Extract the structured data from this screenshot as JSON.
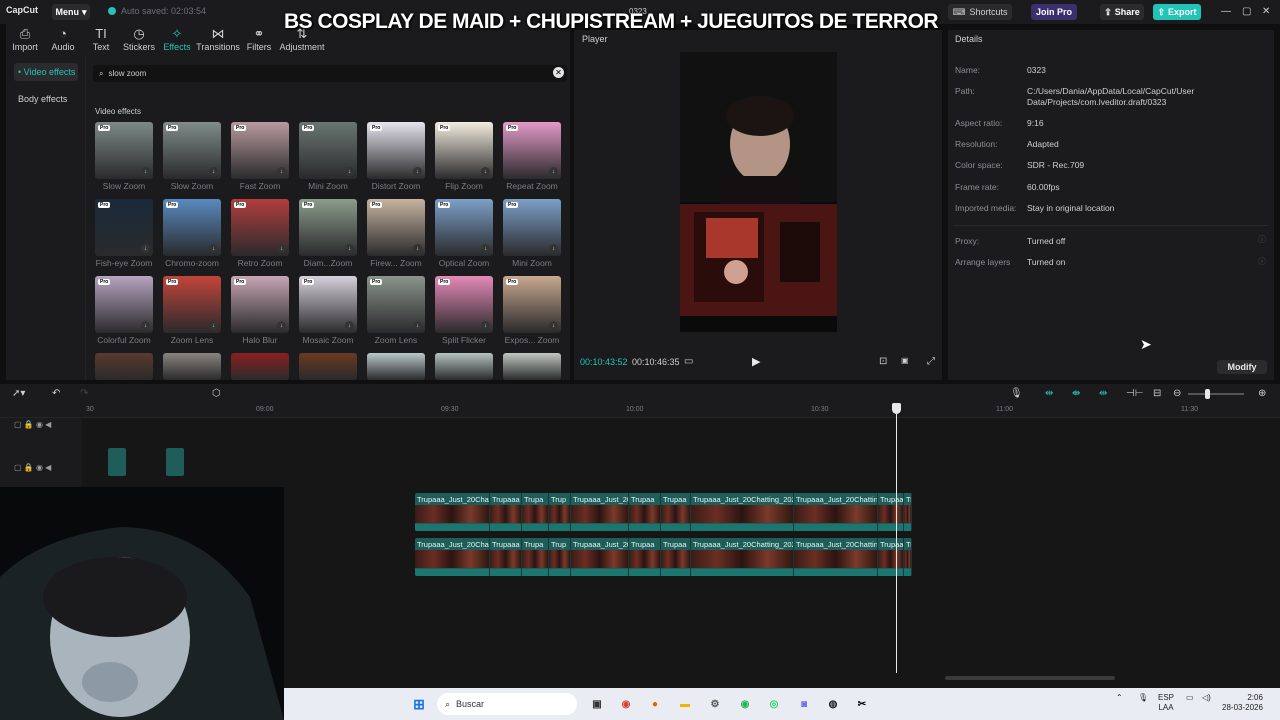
{
  "titlebar": {
    "app_name": "CapCut",
    "menu_label": "Menu",
    "autosave_text": "Auto saved: 02:03:54",
    "overlay_title": "BS COSPLAY DE MAID + CHUPISTREAM + JUEGUITOS DE TERROR",
    "project_name": "0323",
    "shortcuts_label": "Shortcuts",
    "joinpro_label": "Join Pro",
    "share_label": "Share",
    "export_label": "Export"
  },
  "toolbar": {
    "items": [
      {
        "label": "Import",
        "icon": "import-icon"
      },
      {
        "label": "Audio",
        "icon": "audio-icon"
      },
      {
        "label": "Text",
        "icon": "text-icon"
      },
      {
        "label": "Stickers",
        "icon": "stickers-icon"
      },
      {
        "label": "Effects",
        "icon": "effects-icon"
      },
      {
        "label": "Transitions",
        "icon": "transitions-icon"
      },
      {
        "label": "Filters",
        "icon": "filters-icon"
      },
      {
        "label": "Adjustment",
        "icon": "adjustment-icon"
      }
    ],
    "active": "Effects"
  },
  "categories": {
    "video_effects": "• Video effects",
    "body_effects": "Body effects"
  },
  "search": {
    "value": "slow zoom"
  },
  "effects": {
    "section_label": "Video effects",
    "items": [
      {
        "label": "Slow Zoom",
        "color": "#7d8a88"
      },
      {
        "label": "Slow Zoom",
        "color": "#808c8a"
      },
      {
        "label": "Fast Zoom",
        "color": "#b89a9e"
      },
      {
        "label": "Mini Zoom",
        "color": "#6a7672"
      },
      {
        "label": "Distort Zoom",
        "color": "#e6e4ee"
      },
      {
        "label": "Flip Zoom",
        "color": "#f3ecdf"
      },
      {
        "label": "Repeat Zoom",
        "color": "#e39ac7"
      },
      {
        "label": "Fish-eye Zoom",
        "color": "#1a2a3a"
      },
      {
        "label": "Chromo-zoom",
        "color": "#5a8ac0"
      },
      {
        "label": "Retro Zoom",
        "color": "#b13e3e"
      },
      {
        "label": "Diam...Zoom",
        "color": "#8c9c8c"
      },
      {
        "label": "Firew... Zoom",
        "color": "#c7b49f"
      },
      {
        "label": "Optical Zoom",
        "color": "#7ca0c8"
      },
      {
        "label": "Mini Zoom",
        "color": "#7ca0c8"
      },
      {
        "label": "Colorful Zoom",
        "color": "#b6a4c0"
      },
      {
        "label": "Zoom Lens",
        "color": "#c2453b"
      },
      {
        "label": "Halo Blur",
        "color": "#c7a6b4"
      },
      {
        "label": "Mosaic Zoom",
        "color": "#d6d0db"
      },
      {
        "label": "Zoom Lens",
        "color": "#8a948c"
      },
      {
        "label": "Split Flicker",
        "color": "#e58ab8"
      },
      {
        "label": "Expos... Zoom",
        "color": "#c8a890"
      },
      {
        "label": "",
        "color": "#5a3a2e"
      },
      {
        "label": "",
        "color": "#8a8480"
      },
      {
        "label": "",
        "color": "#8a2020"
      },
      {
        "label": "",
        "color": "#6a3a22"
      },
      {
        "label": "",
        "color": "#b9c8c8"
      },
      {
        "label": "",
        "color": "#b6c3c0"
      },
      {
        "label": "",
        "color": "#c0c8c0"
      }
    ]
  },
  "player": {
    "label": "Player",
    "current_time": "00:10:43:52",
    "total_time": "00:10:46:35"
  },
  "details": {
    "title": "Details",
    "rows": [
      {
        "key": "Name:",
        "value": "0323"
      },
      {
        "key": "Path:",
        "value": "C:/Users/Dania/AppData/Local/CapCut/User Data/Projects/com.lveditor.draft/0323"
      },
      {
        "key": "Aspect ratio:",
        "value": "9:16"
      },
      {
        "key": "Resolution:",
        "value": "Adapted"
      },
      {
        "key": "Color space:",
        "value": "SDR - Rec.709"
      },
      {
        "key": "Frame rate:",
        "value": "60.00fps"
      },
      {
        "key": "Imported media:",
        "value": "Stay in original location"
      },
      {
        "key": "Proxy:",
        "value": "Turned off"
      },
      {
        "key": "Arrange layers",
        "value": "Turned on"
      }
    ],
    "modify_label": "Modify"
  },
  "timeline": {
    "ticks": [
      "30",
      "09:00",
      "09:30",
      "10:00",
      "10:30",
      "11:00",
      "11:30"
    ],
    "clip_rows": [
      [
        "Trupaaa_Just_20Chat",
        "Trupaaa",
        "Trupa",
        "Trup",
        "Trupaaa_Just_20",
        "Trupaa",
        "Trupaa",
        "Trupaaa_Just_20Chatting_202",
        "Trupaaa_Just_20Chattin",
        "Trupaa",
        "Trup"
      ],
      [
        "Trupaaa_Just_20Chat",
        "Trupaaa",
        "Trupa",
        "Trup",
        "Trupaaa_Just_20",
        "Trupaa",
        "Trupaa",
        "Trupaaa_Just_20Chatting_202",
        "Trupaaa_Just_20Chattin",
        "Trupaa",
        "Trup"
      ]
    ]
  },
  "taskbar": {
    "search_placeholder": "Buscar",
    "lang_top": "ESP",
    "lang_bottom": "LAA",
    "time": "2:06",
    "date": "28-03-2026"
  },
  "colors": {
    "accent": "#21c4b6",
    "panel": "#1b1b1d",
    "clip": "#1f5d5a"
  }
}
